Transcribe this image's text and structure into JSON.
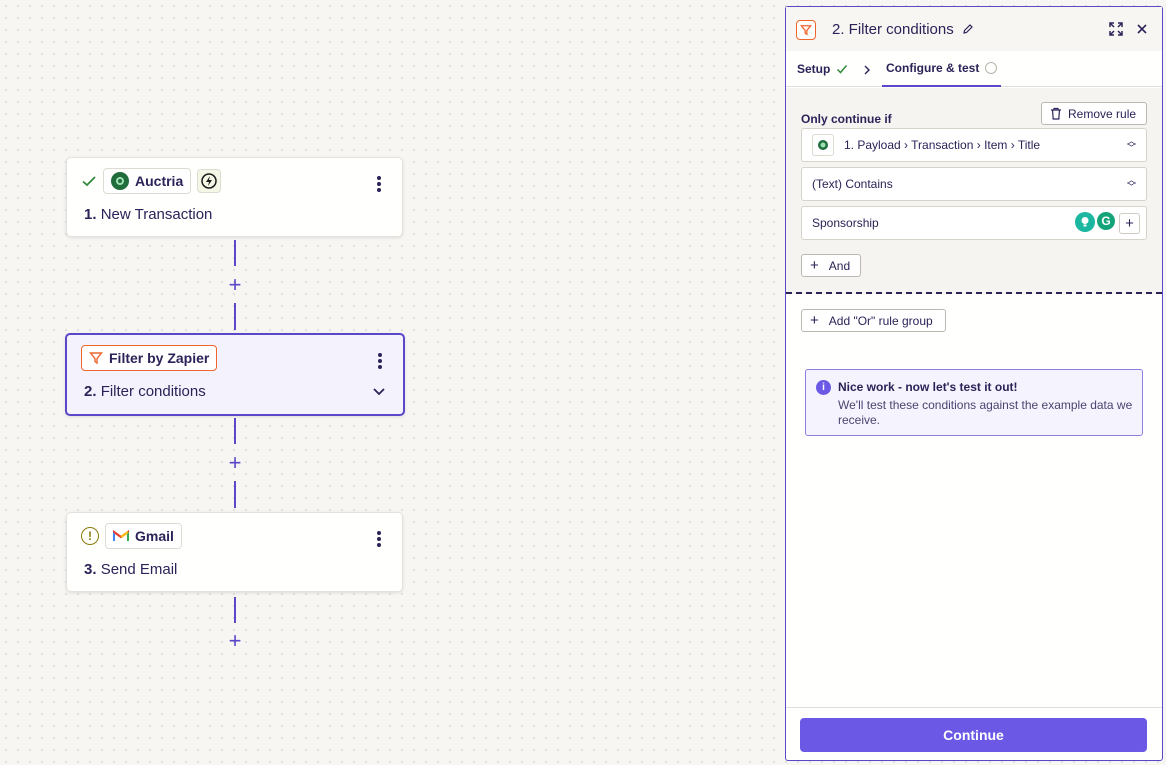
{
  "canvas": {
    "steps": [
      {
        "app": "Auctria",
        "number": "1.",
        "title": "New Transaction"
      },
      {
        "app": "Filter by Zapier",
        "number": "2.",
        "title": "Filter conditions"
      },
      {
        "app": "Gmail",
        "number": "3.",
        "title": "Send Email"
      }
    ]
  },
  "panel": {
    "title": "2. Filter conditions",
    "tabs": [
      {
        "label": "Setup",
        "status": "complete"
      },
      {
        "label": "Configure & test",
        "status": "incomplete"
      }
    ],
    "rule": {
      "heading": "Only continue if",
      "remove_label": "Remove rule",
      "field_value": "1. Payload › Transaction › Item › Title",
      "condition_value": "(Text) Contains",
      "match_value": "Sponsorship",
      "and_label": "And"
    },
    "or_group_label": "Add \"Or\" rule group",
    "info": {
      "title": "Nice work - now let's test it out!",
      "text": "We'll test these conditions against the example data we receive."
    },
    "continue_label": "Continue"
  },
  "colors": {
    "accent": "#5a47c9",
    "button": "#6b59e6",
    "filter_orange": "#f0642e",
    "success_green": "#2f8a3a",
    "warning_olive": "#8a7a10"
  }
}
